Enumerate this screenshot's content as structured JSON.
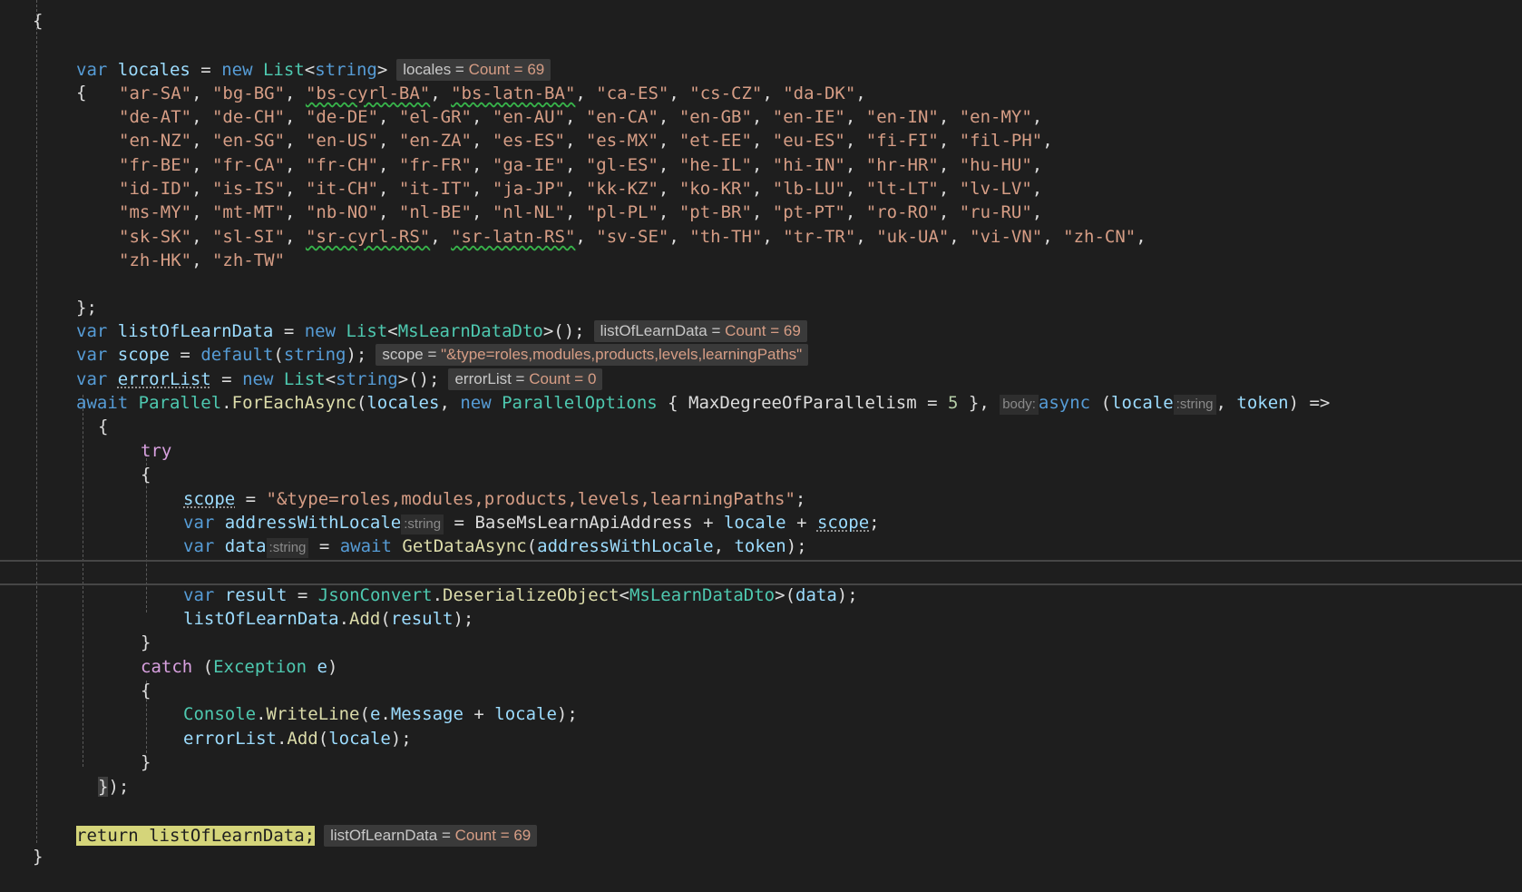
{
  "code": {
    "locales_decl": {
      "kw_var": "var",
      "name": "locales",
      "op": " = ",
      "kw_new": "new",
      "type": "List",
      "generic_open": "<",
      "generic_type": "string",
      "generic_close": ">"
    },
    "locales_hint": {
      "label": "locales = ",
      "value": "Count = 69"
    },
    "open_brace": "{",
    "locale_rows": [
      [
        "\"ar-SA\"",
        "\"bg-BG\"",
        "\"bs-cyrl-BA\"",
        "\"bs-latn-BA\"",
        "\"ca-ES\"",
        "\"cs-CZ\"",
        "\"da-DK\""
      ],
      [
        "\"de-AT\"",
        "\"de-CH\"",
        "\"de-DE\"",
        "\"el-GR\"",
        "\"en-AU\"",
        "\"en-CA\"",
        "\"en-GB\"",
        "\"en-IE\"",
        "\"en-IN\"",
        "\"en-MY\""
      ],
      [
        "\"en-NZ\"",
        "\"en-SG\"",
        "\"en-US\"",
        "\"en-ZA\"",
        "\"es-ES\"",
        "\"es-MX\"",
        "\"et-EE\"",
        "\"eu-ES\"",
        "\"fi-FI\"",
        "\"fil-PH\""
      ],
      [
        "\"fr-BE\"",
        "\"fr-CA\"",
        "\"fr-CH\"",
        "\"fr-FR\"",
        "\"ga-IE\"",
        "\"gl-ES\"",
        "\"he-IL\"",
        "\"hi-IN\"",
        "\"hr-HR\"",
        "\"hu-HU\""
      ],
      [
        "\"id-ID\"",
        "\"is-IS\"",
        "\"it-CH\"",
        "\"it-IT\"",
        "\"ja-JP\"",
        "\"kk-KZ\"",
        "\"ko-KR\"",
        "\"lb-LU\"",
        "\"lt-LT\"",
        "\"lv-LV\""
      ],
      [
        "\"ms-MY\"",
        "\"mt-MT\"",
        "\"nb-NO\"",
        "\"nl-BE\"",
        "\"nl-NL\"",
        "\"pl-PL\"",
        "\"pt-BR\"",
        "\"pt-PT\"",
        "\"ro-RO\"",
        "\"ru-RU\""
      ],
      [
        "\"sk-SK\"",
        "\"sl-SI\"",
        "\"sr-cyrl-RS\"",
        "\"sr-latn-RS\"",
        "\"sv-SE\"",
        "\"th-TH\"",
        "\"tr-TR\"",
        "\"uk-UA\"",
        "\"vi-VN\"",
        "\"zh-CN\""
      ],
      [
        "\"zh-HK\"",
        "\"zh-TW\""
      ]
    ],
    "close_brace_semi": "};",
    "list_decl": {
      "kw_var": "var",
      "name": "listOfLearnData",
      "op": " = ",
      "kw_new": "new",
      "type": "List",
      "lt": "<",
      "dto": "MsLearnDataDto",
      "gt_call": ">();"
    },
    "list_hint": {
      "label": "listOfLearnData = ",
      "value": "Count = 69"
    },
    "scope_decl": {
      "kw_var": "var",
      "name": "scope",
      "op": " = ",
      "kw_default": "default",
      "open": "(",
      "arg": "string",
      "close": ");"
    },
    "scope_hint": {
      "label": "scope = ",
      "value": "\"&type=roles,modules,products,levels,learningPaths\""
    },
    "error_decl": {
      "kw_var": "var",
      "name": "errorList",
      "op": " = ",
      "kw_new": "new",
      "type": "List",
      "lt": "<",
      "arg": "string",
      "gt_call": ">();"
    },
    "error_hint": {
      "label": "errorList = ",
      "value": "Count = 0"
    },
    "foreach": {
      "kw_await": "await",
      "parallel": "Parallel",
      "dot": ".",
      "method": "ForEachAsync",
      "open": "(",
      "arg1": "locales",
      "comma": ", ",
      "kw_new": "new",
      "opts_type": "ParallelOptions",
      "opts_body": " { MaxDegreeOfParallelism = ",
      "num": "5",
      "opts_close": " }, ",
      "param_hint": "body:",
      "kw_async": "async",
      "lambda_open": " (",
      "p1": "locale",
      "p1_type": ":string",
      "comma2": ", ",
      "p2": "token",
      "arrow": ") =>"
    },
    "lambda_open_brace": "{",
    "kw_try": "try",
    "try_open": "{",
    "scope_assign": {
      "name": "scope",
      "op": " = ",
      "value": "\"&type=roles,modules,products,levels,learningPaths\"",
      "semi": ";"
    },
    "address_line": {
      "kw_var": "var",
      "name": "addressWithLocale",
      "type_hint": ":string",
      "op": " = ",
      "base": "BaseMsLearnApiAddress",
      "plus1": " + ",
      "locale": "locale",
      "plus2": " + ",
      "scope": "scope",
      "semi": ";"
    },
    "data_line": {
      "kw_var": "var",
      "name": "data",
      "type_hint": ":string",
      "op": " = ",
      "kw_await": "await",
      "method": "GetDataAsync",
      "open": "(",
      "arg1": "addressWithLocale",
      "comma": ", ",
      "arg2": "token",
      "close": ");"
    },
    "result_line": {
      "kw_var": "var",
      "name": "result",
      "op": " = ",
      "cls": "JsonConvert",
      "dot": ".",
      "method": "DeserializeObject",
      "lt": "<",
      "dto": "MsLearnDataDto",
      "gt": ">(",
      "arg": "data",
      "close": ");"
    },
    "add_result_line": {
      "obj": "listOfLearnData",
      "dot": ".",
      "method": "Add",
      "open": "(",
      "arg": "result",
      "close": ");"
    },
    "try_close": "}",
    "catch_line": {
      "kw_catch": "catch",
      "open": " (",
      "type": "Exception",
      "var": " e",
      "close": ")"
    },
    "catch_open": "{",
    "console_line": {
      "cls": "Console",
      "dot": ".",
      "method": "WriteLine",
      "open": "(",
      "obj": "e",
      "dot2": ".",
      "prop": "Message",
      "plus": " + ",
      "arg": "locale",
      "close": ");"
    },
    "error_add_line": {
      "obj": "errorList",
      "dot": ".",
      "method": "Add",
      "open": "(",
      "arg": "locale",
      "close": ");"
    },
    "catch_close": "}",
    "lambda_close": {
      "brace": "}",
      "rest": ");"
    },
    "return_line": {
      "text": "return listOfLearnData;"
    },
    "return_hint": {
      "label": "listOfLearnData = ",
      "value": "Count = 69"
    },
    "method_close": "}",
    "top_brace": "{"
  }
}
